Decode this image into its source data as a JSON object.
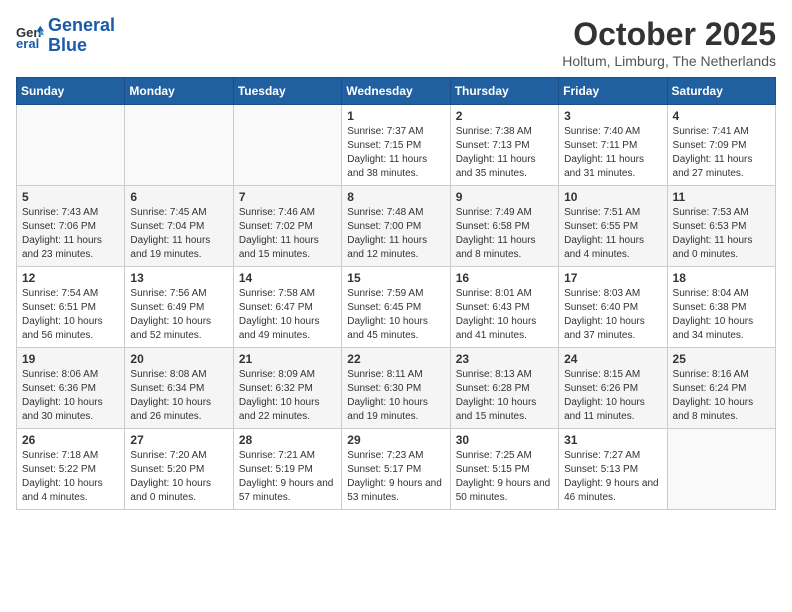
{
  "logo": {
    "text_general": "General",
    "text_blue": "Blue"
  },
  "title": "October 2025",
  "location": "Holtum, Limburg, The Netherlands",
  "days_of_week": [
    "Sunday",
    "Monday",
    "Tuesday",
    "Wednesday",
    "Thursday",
    "Friday",
    "Saturday"
  ],
  "weeks": [
    [
      {
        "day": "",
        "info": ""
      },
      {
        "day": "",
        "info": ""
      },
      {
        "day": "",
        "info": ""
      },
      {
        "day": "1",
        "info": "Sunrise: 7:37 AM\nSunset: 7:15 PM\nDaylight: 11 hours and 38 minutes."
      },
      {
        "day": "2",
        "info": "Sunrise: 7:38 AM\nSunset: 7:13 PM\nDaylight: 11 hours and 35 minutes."
      },
      {
        "day": "3",
        "info": "Sunrise: 7:40 AM\nSunset: 7:11 PM\nDaylight: 11 hours and 31 minutes."
      },
      {
        "day": "4",
        "info": "Sunrise: 7:41 AM\nSunset: 7:09 PM\nDaylight: 11 hours and 27 minutes."
      }
    ],
    [
      {
        "day": "5",
        "info": "Sunrise: 7:43 AM\nSunset: 7:06 PM\nDaylight: 11 hours and 23 minutes."
      },
      {
        "day": "6",
        "info": "Sunrise: 7:45 AM\nSunset: 7:04 PM\nDaylight: 11 hours and 19 minutes."
      },
      {
        "day": "7",
        "info": "Sunrise: 7:46 AM\nSunset: 7:02 PM\nDaylight: 11 hours and 15 minutes."
      },
      {
        "day": "8",
        "info": "Sunrise: 7:48 AM\nSunset: 7:00 PM\nDaylight: 11 hours and 12 minutes."
      },
      {
        "day": "9",
        "info": "Sunrise: 7:49 AM\nSunset: 6:58 PM\nDaylight: 11 hours and 8 minutes."
      },
      {
        "day": "10",
        "info": "Sunrise: 7:51 AM\nSunset: 6:55 PM\nDaylight: 11 hours and 4 minutes."
      },
      {
        "day": "11",
        "info": "Sunrise: 7:53 AM\nSunset: 6:53 PM\nDaylight: 11 hours and 0 minutes."
      }
    ],
    [
      {
        "day": "12",
        "info": "Sunrise: 7:54 AM\nSunset: 6:51 PM\nDaylight: 10 hours and 56 minutes."
      },
      {
        "day": "13",
        "info": "Sunrise: 7:56 AM\nSunset: 6:49 PM\nDaylight: 10 hours and 52 minutes."
      },
      {
        "day": "14",
        "info": "Sunrise: 7:58 AM\nSunset: 6:47 PM\nDaylight: 10 hours and 49 minutes."
      },
      {
        "day": "15",
        "info": "Sunrise: 7:59 AM\nSunset: 6:45 PM\nDaylight: 10 hours and 45 minutes."
      },
      {
        "day": "16",
        "info": "Sunrise: 8:01 AM\nSunset: 6:43 PM\nDaylight: 10 hours and 41 minutes."
      },
      {
        "day": "17",
        "info": "Sunrise: 8:03 AM\nSunset: 6:40 PM\nDaylight: 10 hours and 37 minutes."
      },
      {
        "day": "18",
        "info": "Sunrise: 8:04 AM\nSunset: 6:38 PM\nDaylight: 10 hours and 34 minutes."
      }
    ],
    [
      {
        "day": "19",
        "info": "Sunrise: 8:06 AM\nSunset: 6:36 PM\nDaylight: 10 hours and 30 minutes."
      },
      {
        "day": "20",
        "info": "Sunrise: 8:08 AM\nSunset: 6:34 PM\nDaylight: 10 hours and 26 minutes."
      },
      {
        "day": "21",
        "info": "Sunrise: 8:09 AM\nSunset: 6:32 PM\nDaylight: 10 hours and 22 minutes."
      },
      {
        "day": "22",
        "info": "Sunrise: 8:11 AM\nSunset: 6:30 PM\nDaylight: 10 hours and 19 minutes."
      },
      {
        "day": "23",
        "info": "Sunrise: 8:13 AM\nSunset: 6:28 PM\nDaylight: 10 hours and 15 minutes."
      },
      {
        "day": "24",
        "info": "Sunrise: 8:15 AM\nSunset: 6:26 PM\nDaylight: 10 hours and 11 minutes."
      },
      {
        "day": "25",
        "info": "Sunrise: 8:16 AM\nSunset: 6:24 PM\nDaylight: 10 hours and 8 minutes."
      }
    ],
    [
      {
        "day": "26",
        "info": "Sunrise: 7:18 AM\nSunset: 5:22 PM\nDaylight: 10 hours and 4 minutes."
      },
      {
        "day": "27",
        "info": "Sunrise: 7:20 AM\nSunset: 5:20 PM\nDaylight: 10 hours and 0 minutes."
      },
      {
        "day": "28",
        "info": "Sunrise: 7:21 AM\nSunset: 5:19 PM\nDaylight: 9 hours and 57 minutes."
      },
      {
        "day": "29",
        "info": "Sunrise: 7:23 AM\nSunset: 5:17 PM\nDaylight: 9 hours and 53 minutes."
      },
      {
        "day": "30",
        "info": "Sunrise: 7:25 AM\nSunset: 5:15 PM\nDaylight: 9 hours and 50 minutes."
      },
      {
        "day": "31",
        "info": "Sunrise: 7:27 AM\nSunset: 5:13 PM\nDaylight: 9 hours and 46 minutes."
      },
      {
        "day": "",
        "info": ""
      }
    ]
  ]
}
